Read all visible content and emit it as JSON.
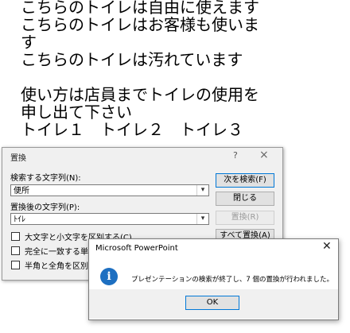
{
  "slide": {
    "lines": [
      "こちらのトイレは自由に使えます",
      "こちらのトイレはお客様も使いま",
      "す",
      "こちらのトイレは汚れています",
      "",
      "使い方は店員までトイレの使用を",
      "申し出て下さい",
      "トイレ１　トイレ２　トイレ３"
    ]
  },
  "replace_dialog": {
    "title": "置換",
    "help_glyph": "?",
    "close_glyph": "×",
    "find_label": "検索する文字列(N):",
    "find_value": "便所",
    "replace_label": "置換後の文字列(P):",
    "replace_value": "ﾄｲﾚ",
    "buttons": {
      "find_next": "次を検索(F)",
      "close": "閉じる",
      "replace": "置換(R)",
      "replace_all": "すべて置換(A)"
    },
    "options": [
      "大文字と小文字を区別する(C)",
      "完全に一致する単語",
      "半角と全角を区別す"
    ]
  },
  "message_box": {
    "title": "Microsoft PowerPoint",
    "close_glyph": "✕",
    "icon": "info-icon",
    "icon_glyph": "i",
    "message": "プレゼンテーションの検索が終了し、7 個の置換が行われました。",
    "ok_label": "OK"
  },
  "colors": {
    "info_icon": "#1d6fc1",
    "default_button_border": "#0078d7",
    "dialog_background": "#f0f0f0"
  }
}
